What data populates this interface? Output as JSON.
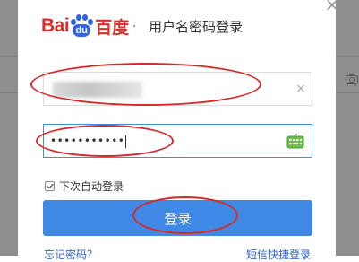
{
  "dialog": {
    "close_glyph": "×",
    "logo": {
      "left_text": "Bai",
      "paw_text": "du",
      "cn_text": "百度"
    },
    "separator": "·",
    "title": "用户名密码登录"
  },
  "form": {
    "username": {
      "value": "",
      "clear_glyph": "×"
    },
    "password": {
      "masked_value": "•••••••••••"
    },
    "remember_label": "下次自动登录",
    "remember_checked": true,
    "login_button": "登录"
  },
  "footer": {
    "forgot_link": "忘记密码？",
    "sms_link": "短信快捷登录"
  },
  "colors": {
    "brand_red": "#de2b2b",
    "brand_blue": "#2f66e0",
    "button_blue": "#3f88e6",
    "annotation_red": "#d42a2a"
  }
}
